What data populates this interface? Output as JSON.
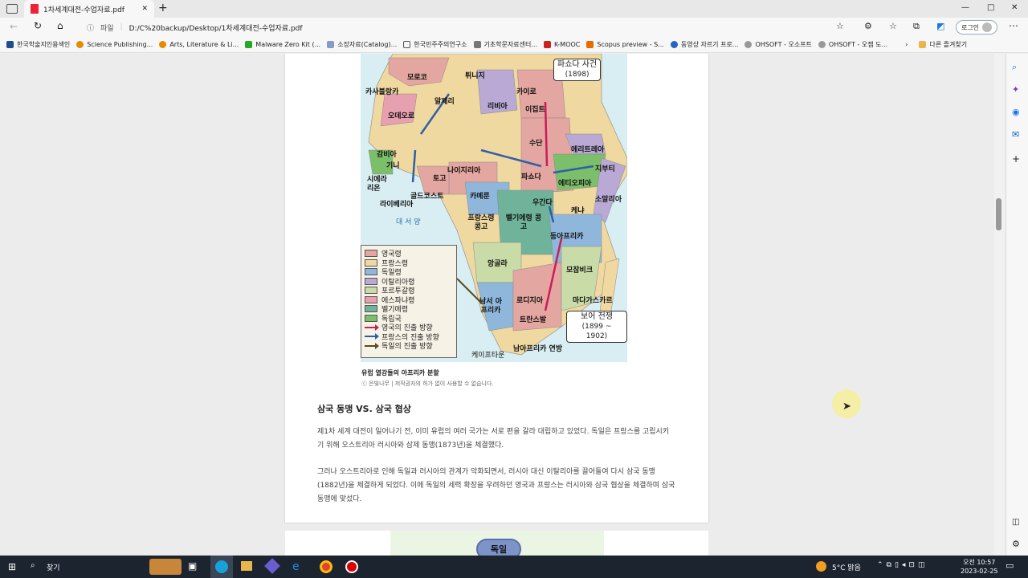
{
  "tab": {
    "title": "1차세계대전-수업자료.pdf",
    "new_tab": "+"
  },
  "window": {
    "minimize": "—",
    "maximize": "□",
    "close": "✕"
  },
  "address": {
    "scheme_label": "파일",
    "path": "D:/C%20backup/Desktop/1차세계대전-수업자료.pdf"
  },
  "login": "로그인",
  "bookmarks": [
    "한국학술지인용색인",
    "Science Publishing...",
    "Arts, Literature & Li...",
    "Malware Zero Kit (...",
    "소장자료(Catalog)...",
    "한국민주주의연구소",
    "기초학문자료센터...",
    "K-MOOC",
    "Scopus preview - S...",
    "동영상 자르기 프로...",
    "OHSOFT - 오소프트",
    "OHSOFT - 오젬 도...",
    "다른 즐겨찾기"
  ],
  "map": {
    "places": [
      "모로코",
      "튀니지",
      "카사블랑카",
      "알제리",
      "카이로",
      "이집트",
      "리비아",
      "오데오로",
      "수단",
      "에리트레아",
      "감비아",
      "기니",
      "시에라 리온",
      "라이베리아",
      "골드코스트",
      "토고",
      "나이지리아",
      "파쇼다",
      "지부티",
      "에티오피아",
      "카메룬",
      "우간다",
      "소말리아",
      "케냐",
      "대 서 양",
      "프랑스령 콩고",
      "벨기에령 콩고",
      "동아프리카",
      "앙골라",
      "모잠비크",
      "마다가스카르",
      "남서 아프리카",
      "로디지아",
      "트란스발",
      "남아프리카 연방",
      "케이프타운"
    ],
    "fashoda": {
      "title": "파쇼다 사건",
      "year": "(1898)"
    },
    "boer": {
      "title": "보어 전쟁",
      "year": "(1899 ~ 1902)"
    },
    "legend": [
      {
        "label": "영국령",
        "color": "#e4a6a0"
      },
      {
        "label": "프랑스령",
        "color": "#f0d9a0"
      },
      {
        "label": "독일령",
        "color": "#8fb7dc"
      },
      {
        "label": "이탈리아령",
        "color": "#b9a9d4"
      },
      {
        "label": "포르투갈령",
        "color": "#c9dba7"
      },
      {
        "label": "에스파냐령",
        "color": "#e7a0b0"
      },
      {
        "label": "벨기에령",
        "color": "#6fb39a"
      },
      {
        "label": "독립국",
        "color": "#7cbf6a"
      }
    ],
    "arrows": [
      {
        "label": "영국의 진출 방향",
        "color": "#c81e5a"
      },
      {
        "label": "프랑스의 진출 방향",
        "color": "#2d5fa8"
      },
      {
        "label": "독일의 진출 방향",
        "color": "#5a4a20"
      }
    ],
    "caption": "유럽 열강들의 아프리카 분할",
    "credit": "ⓒ 은빛나무 | 저작권자의 허가 없이 사용할 수 없습니다."
  },
  "section": {
    "heading": "삼국 동맹 VS. 삼국 협상",
    "para1": "제1차 세계 대전이 일어나기 전, 이미 유럽의 여러 국가는 서로 편을 갈라 대립하고 있었다. 독일은 프랑스를 고립시키기 위해 오스트리아 러시아와 삼제 동맹(1873년)을 체결했다.",
    "para2": "그러나 오스트리아로 인해 독일과 러시아의 관계가 악화되면서, 러시아 대신 이탈리아를 끌어들여 다시 삼국 동맹(1882년)을 체결하게 되었다. 이에 독일의 세력 확장을 우려하던 영국과 프랑스는 러시아와 삼국 협상을 체결하며 삼국 동맹에 맞섰다."
  },
  "next_page_label": "독일",
  "taskbar": {
    "search": "찾기",
    "weather": "5°C 맑음",
    "time": "오전 10:57",
    "date": "2023-02-25"
  }
}
